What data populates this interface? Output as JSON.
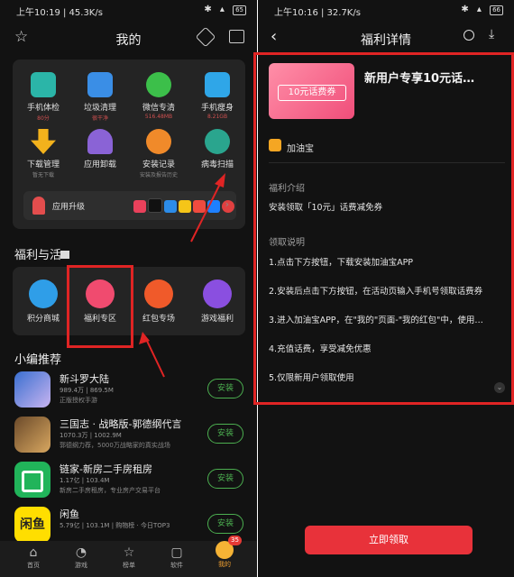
{
  "left": {
    "status": {
      "time": "上午10:19 | 45.3K/s",
      "battery": "65"
    },
    "title": "我的",
    "tools": [
      {
        "label": "手机体检",
        "sub": "80分"
      },
      {
        "label": "垃圾清理",
        "sub": "很干净"
      },
      {
        "label": "微信专清",
        "sub": "516.48MB"
      },
      {
        "label": "手机瘦身",
        "sub": "8.21GB"
      },
      {
        "label": "下载管理",
        "sub": "暂无下载"
      },
      {
        "label": "应用卸载",
        "sub": ""
      },
      {
        "label": "安装记录",
        "sub": "安装及报告历史"
      },
      {
        "label": "病毒扫描",
        "sub": ""
      }
    ],
    "upgrade": {
      "label": "应用升级"
    },
    "welfare_title": "福利与活",
    "welfare": [
      {
        "label": "积分商城"
      },
      {
        "label": "福利专区"
      },
      {
        "label": "红包专场"
      },
      {
        "label": "游戏福利"
      }
    ],
    "editor_title": "小编推荐",
    "apps": [
      {
        "name": "新斗罗大陆",
        "meta": "989.4万 | 869.5M",
        "desc": "正版授权手游",
        "btn": "安装"
      },
      {
        "name": "三国志 · 战略版-郭德纲代言",
        "meta": "1070.3万 | 1002.9M",
        "desc": "郭德纲力荐，5000万战略家的真实战场",
        "btn": "安装"
      },
      {
        "name": "链家-新房二手房租房",
        "meta": "1.17亿 | 103.4M",
        "desc": "新房二手房租房，专业房产交易平台",
        "btn": "安装"
      },
      {
        "name": "闲鱼",
        "meta": "5.79亿 | 103.1M | 购物榜 · 今日TOP3",
        "desc": "",
        "btn": "安装",
        "logo": "闲鱼"
      }
    ],
    "nav": [
      {
        "label": "首页"
      },
      {
        "label": "游戏"
      },
      {
        "label": "榜单"
      },
      {
        "label": "软件"
      },
      {
        "label": "我的",
        "badge": "35"
      }
    ]
  },
  "right": {
    "status": {
      "time": "上午10:16 | 32.7K/s",
      "battery": "66"
    },
    "title": "福利详情",
    "coupon_text": "10元话费券",
    "headline": "新用户专享10元话…",
    "provider": "加油宝",
    "intro_title": "福利介绍",
    "intro": "安装领取「10元」话费减免券",
    "steps_title": "领取说明",
    "steps": [
      "1.点击下方按钮，下载安装加油宝APP",
      "2.安装后点击下方按钮，在活动页输入手机号领取话费券",
      "3.进入加油宝APP，在\"我的\"页面-\"我的红包\"中，使用…",
      "4.充值话费，享受减免优惠",
      "5.仅限新用户领取使用"
    ],
    "claim_btn": "立即领取"
  },
  "colors": {
    "accent_red": "#e02424",
    "install_green": "#4caf50",
    "claim_red": "#e8323a"
  }
}
